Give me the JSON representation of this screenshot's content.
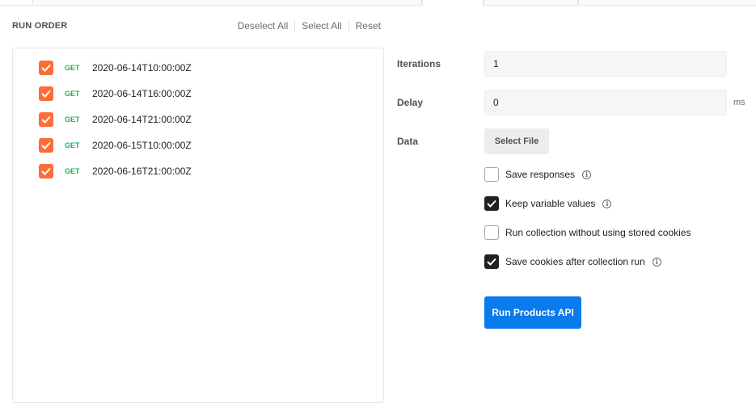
{
  "run_order": {
    "title": "RUN ORDER",
    "actions": [
      "Deselect All",
      "Select All",
      "Reset"
    ]
  },
  "requests": [
    {
      "method": "GET",
      "name": "2020-06-14T10:00:00Z",
      "checked": true
    },
    {
      "method": "GET",
      "name": "2020-06-14T16:00:00Z",
      "checked": true
    },
    {
      "method": "GET",
      "name": "2020-06-14T21:00:00Z",
      "checked": true
    },
    {
      "method": "GET",
      "name": "2020-06-15T10:00:00Z",
      "checked": true
    },
    {
      "method": "GET",
      "name": "2020-06-16T21:00:00Z",
      "checked": true
    }
  ],
  "settings": {
    "iterations_label": "Iterations",
    "iterations_value": "1",
    "delay_label": "Delay",
    "delay_value": "0",
    "delay_unit": "ms",
    "data_label": "Data",
    "select_file_label": "Select File",
    "options": [
      {
        "label": "Save responses",
        "checked": false,
        "info": true
      },
      {
        "label": "Keep variable values",
        "checked": true,
        "info": true
      },
      {
        "label": "Run collection without using stored cookies",
        "checked": false,
        "info": false
      },
      {
        "label": "Save cookies after collection run",
        "checked": true,
        "info": true
      }
    ],
    "run_button_label": "Run Products API"
  },
  "icons": {
    "request_checkbox": "checkmark-icon",
    "info": "info-icon"
  },
  "colors": {
    "accent_orange": "#ff6c37",
    "get_method": "#0cbb52",
    "run_button": "#097bed",
    "checked_box": "#212121"
  }
}
